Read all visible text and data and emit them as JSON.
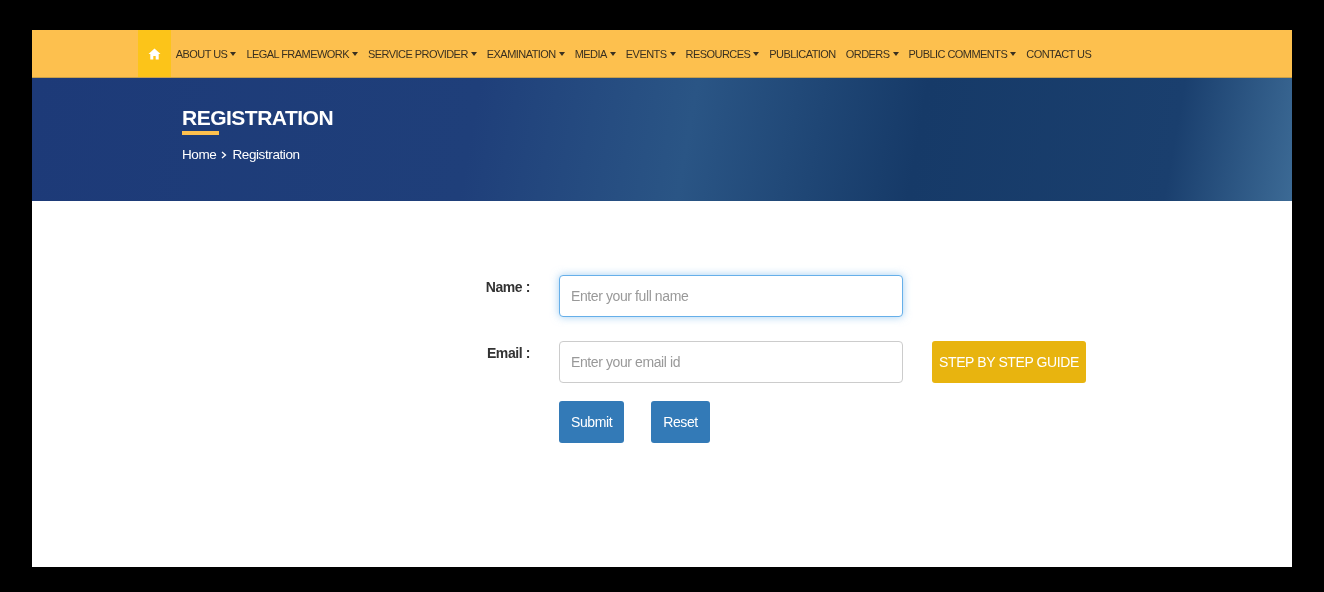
{
  "nav": {
    "items": [
      {
        "kind": "home",
        "selected": true
      },
      {
        "kind": "link",
        "label": "ABOUT US",
        "dropdown": true,
        "selected": false
      },
      {
        "kind": "link",
        "label": "LEGAL FRAMEWORK",
        "dropdown": true,
        "selected": false
      },
      {
        "kind": "link",
        "label": "SERVICE PROVIDER",
        "dropdown": true,
        "selected": false
      },
      {
        "kind": "link",
        "label": "EXAMINATION",
        "dropdown": true,
        "selected": false
      },
      {
        "kind": "link",
        "label": "MEDIA",
        "dropdown": true,
        "selected": false
      },
      {
        "kind": "link",
        "label": "EVENTS",
        "dropdown": true,
        "selected": false
      },
      {
        "kind": "link",
        "label": "RESOURCES",
        "dropdown": true,
        "selected": false
      },
      {
        "kind": "link",
        "label": "PUBLICATION",
        "dropdown": false,
        "selected": false
      },
      {
        "kind": "link",
        "label": "ORDERS",
        "dropdown": true,
        "selected": false
      },
      {
        "kind": "link",
        "label": "PUBLIC COMMENTS",
        "dropdown": true,
        "selected": false
      },
      {
        "kind": "link",
        "label": "CONTACT US",
        "dropdown": false,
        "selected": false
      }
    ]
  },
  "banner": {
    "title": "REGISTRATION",
    "breadcrumb": [
      "Home",
      "Registration"
    ]
  },
  "form": {
    "fields": [
      {
        "label": "Name :",
        "placeholder": "Enter your full name",
        "focused": true
      },
      {
        "label": "Email :",
        "placeholder": "Enter your email id",
        "focused": false
      }
    ],
    "guide_button": "STEP BY STEP GUIDE",
    "buttons": [
      "Submit",
      "Reset"
    ]
  }
}
